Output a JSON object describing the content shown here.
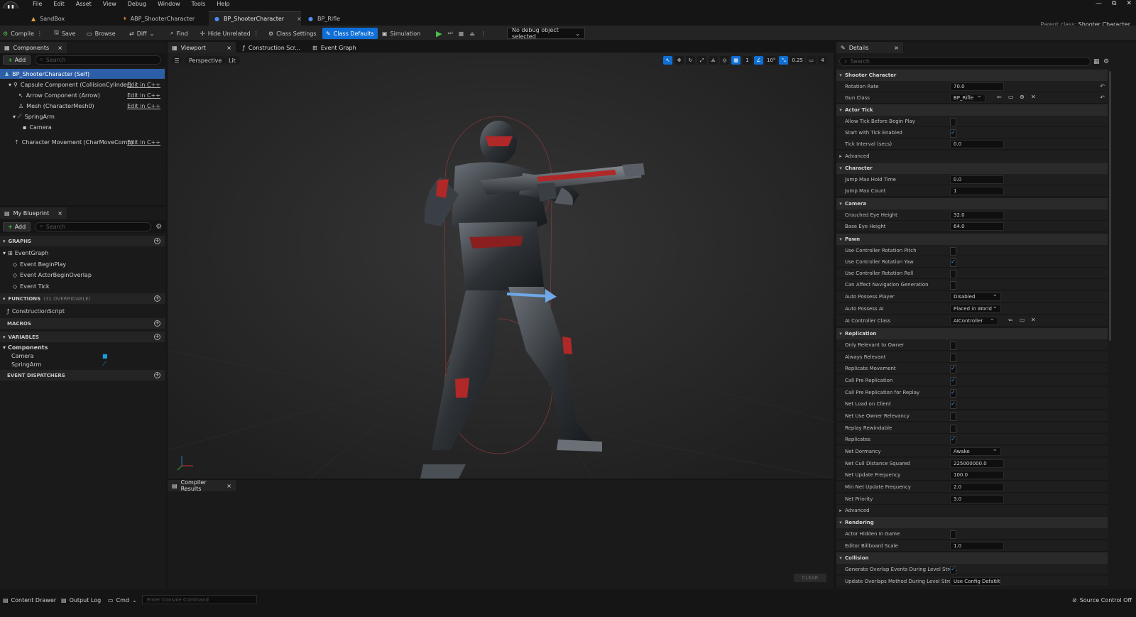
{
  "menu": {
    "logo": "U",
    "items": [
      "File",
      "Edit",
      "Asset",
      "View",
      "Debug",
      "Window",
      "Tools",
      "Help"
    ]
  },
  "window_controls": [
    "—",
    "⧉",
    "✕"
  ],
  "doc_tabs": [
    {
      "label": "SandBox"
    },
    {
      "label": "ABP_ShooterCharacter"
    },
    {
      "label": "BP_ShooterCharacter",
      "close": "×"
    },
    {
      "label": "BP_Rifle"
    }
  ],
  "parent_class": {
    "label": "Parent class:",
    "value": "Shooter Character"
  },
  "toolbar": {
    "compile": "Compile",
    "save": "Save",
    "browse": "Browse",
    "diff": "Diff",
    "find": "Find",
    "hide_unrelated": "Hide Unrelated",
    "class_settings": "Class Settings",
    "class_defaults": "Class Defaults",
    "simulation": "Simulation",
    "debug_object": "No debug object selected"
  },
  "components_panel": {
    "tab": "Components",
    "close": "×",
    "add": "Add",
    "search_placeholder": "Search",
    "items": [
      {
        "label": "BP_ShooterCharacter (Self)",
        "edit": ""
      },
      {
        "label": "Capsule Component (CollisionCylinder)",
        "edit": "Edit in C++"
      },
      {
        "label": "Arrow Component (Arrow)",
        "edit": "Edit in C++"
      },
      {
        "label": "Mesh (CharacterMesh0)",
        "edit": "Edit in C++"
      },
      {
        "label": "SpringArm",
        "edit": ""
      },
      {
        "label": "Camera",
        "edit": ""
      },
      {
        "label": "Character Movement (CharMoveComp)",
        "edit": "Edit in C++"
      }
    ]
  },
  "my_blueprint": {
    "tab": "My Blueprint",
    "close": "×",
    "add": "Add",
    "search_placeholder": "Search",
    "graphs_hdr": "GRAPHS",
    "event_graph": "EventGraph",
    "events": [
      "Event BeginPlay",
      "Event ActorBeginOverlap",
      "Event Tick"
    ],
    "functions_hdr": "FUNCTIONS",
    "functions_note": "(31 OVERRIDABLE)",
    "construction": "ConstructionScript",
    "macros_hdr": "MACROS",
    "variables_hdr": "VARIABLES",
    "components_cat": "Components",
    "vars": [
      "Camera",
      "SpringArm"
    ],
    "dispatchers_hdr": "EVENT DISPATCHERS"
  },
  "viewport": {
    "tabs": [
      "Viewport",
      "Construction Scr...",
      "Event Graph"
    ],
    "close": "×",
    "perspective": "Perspective",
    "lit": "Lit",
    "grid_snap": "1",
    "angle_snap": "10°",
    "scale_snap": "0.25",
    "cam_speed": "4"
  },
  "compiler": {
    "tab": "Compiler Results",
    "close": "×",
    "clear": "CLEAR"
  },
  "details": {
    "tab": "Details",
    "close": "×",
    "search_placeholder": "Search",
    "cat_shooter": "Shooter Character",
    "rotation_rate_lbl": "Rotation Rate",
    "rotation_rate": "70.0",
    "gun_class_lbl": "Gun Class",
    "gun_class": "BP_Rifle",
    "cat_actor_tick": "Actor Tick",
    "allow_tick_lbl": "Allow Tick Before Begin Play",
    "start_tick_lbl": "Start with Tick Enabled",
    "tick_interval_lbl": "Tick Interval (secs)",
    "tick_interval": "0.0",
    "advanced": "Advanced",
    "cat_character": "Character",
    "jump_hold_lbl": "Jump Max Hold Time",
    "jump_hold": "0.0",
    "jump_count_lbl": "Jump Max Count",
    "jump_count": "1",
    "cat_camera": "Camera",
    "crouched_eye_lbl": "Crouched Eye Height",
    "crouched_eye": "32.0",
    "base_eye_lbl": "Base Eye Height",
    "base_eye": "64.0",
    "cat_pawn": "Pawn",
    "ucr_pitch_lbl": "Use Controller Rotation Pitch",
    "ucr_yaw_lbl": "Use Controller Rotation Yaw",
    "ucr_roll_lbl": "Use Controller Rotation Roll",
    "can_affect_nav_lbl": "Can Affect Navigation Generation",
    "auto_possess_player_lbl": "Auto Possess Player",
    "auto_possess_player": "Disabled",
    "auto_possess_ai_lbl": "Auto Possess AI",
    "auto_possess_ai": "Placed in World",
    "ai_controller_lbl": "AI Controller Class",
    "ai_controller": "AIController",
    "cat_replication": "Replication",
    "only_relevant_lbl": "Only Relevant to Owner",
    "always_relevant_lbl": "Always Relevant",
    "replicate_movement_lbl": "Replicate Movement",
    "call_pre_rep_lbl": "Call Pre Replication",
    "call_pre_rep_replay_lbl": "Call Pre Replication for Replay",
    "net_load_client_lbl": "Net Load on Client",
    "net_use_owner_lbl": "Net Use Owner Relevancy",
    "replay_rewindable_lbl": "Replay Rewindable",
    "replicates_lbl": "Replicates",
    "net_dormancy_lbl": "Net Dormancy",
    "net_dormancy": "Awake",
    "net_cull_lbl": "Net Cull Distance Squared",
    "net_cull": "225000000.0",
    "net_update_freq_lbl": "Net Update Frequency",
    "net_update_freq": "100.0",
    "min_net_update_lbl": "Min Net Update Frequency",
    "min_net_update": "2.0",
    "net_priority_lbl": "Net Priority",
    "net_priority": "3.0",
    "cat_rendering": "Rendering",
    "actor_hidden_lbl": "Actor Hidden In Game",
    "billboard_scale_lbl": "Editor Billboard Scale",
    "billboard_scale": "1.0",
    "cat_collision": "Collision",
    "gen_overlap_lbl": "Generate Overlap Events During Level Stre...",
    "update_overlap_lbl": "Update Overlaps Method During Level Stre...",
    "update_overlap": "Use Config Default"
  },
  "statusbar": {
    "content_drawer": "Content Drawer",
    "output_log": "Output Log",
    "cmd": "Cmd",
    "console_placeholder": "Enter Console Command",
    "source_control": "Source Control Off"
  }
}
